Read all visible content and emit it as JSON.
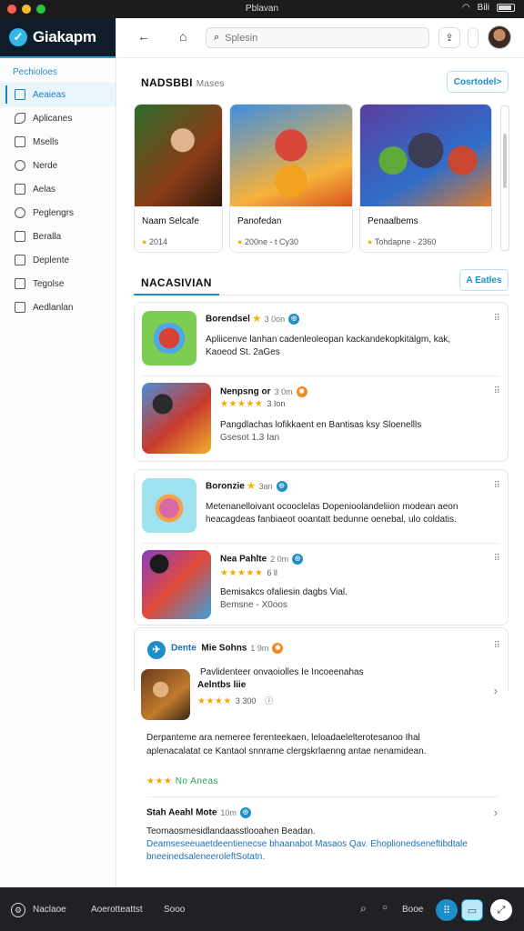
{
  "system": {
    "title": "Pblavan",
    "battery_label": "Bili"
  },
  "sidebar": {
    "brand": "Giakapm",
    "section": "Pechioloes",
    "items": [
      {
        "label": "Aeaieas",
        "icon": "apps-icon"
      },
      {
        "label": "Aplicanes",
        "icon": "leaf-icon"
      },
      {
        "label": "Msells",
        "icon": "grid-icon"
      },
      {
        "label": "Nerde",
        "icon": "user-icon"
      },
      {
        "label": "Aelas",
        "icon": "shield-icon"
      },
      {
        "label": "Peglengrs",
        "icon": "gear-icon"
      },
      {
        "label": "Beralla",
        "icon": "document-icon"
      },
      {
        "label": "Deplente",
        "icon": "edit-icon"
      },
      {
        "label": "Tegolse",
        "icon": "list-icon"
      },
      {
        "label": "Aedlanlan",
        "icon": "book-icon"
      }
    ]
  },
  "header": {
    "search_placeholder": "Splesin"
  },
  "featured": {
    "title": "NADSBBI",
    "subtitle": "Mases",
    "action": "Cosrtodel>",
    "cards": [
      {
        "name": "Naam Selcafe",
        "meta": "2014"
      },
      {
        "name": "Panofedan",
        "meta": "200ne - t Cy30"
      },
      {
        "name": "Penaalbems",
        "meta": "Tohdapne - 2360"
      }
    ]
  },
  "list_section": {
    "title": "NACASIVIAN",
    "action": "A Eatles"
  },
  "apps": [
    {
      "name": "Borendsel",
      "time": "3 0on",
      "desc": "Apliicenve lanhan cadenleoleopan kackandekopkitalgm, kak, Kaoeod St. 2aGes"
    },
    {
      "name": "Nenpsng or",
      "time": "3 0m",
      "rating_text": "3 Ion",
      "desc": "Pangdlachas lofikkaent en Bantisas ksy Sloenellls",
      "sub": "Gsesot 1.3 Ian"
    },
    {
      "name": "Boronzie",
      "time": "3an",
      "desc": "Metenanelloivant ocooclelas Dopenioolandeliion modean aeon heacagdeas fanbiaeot ooantatt bedunne oenebal, ulo coldatis."
    },
    {
      "name": "Nea Pahlte",
      "time": "2 0m",
      "rating_text": "6 ll",
      "desc": "Bemisakcs ofaliesin dagbs Vial.",
      "sub": "Bemsne - X0oos"
    },
    {
      "name": "Dente",
      "extra": "Mie Sohns",
      "time": "1 9m",
      "desc": "Pavlidenteer onvaoiolles Ie Incoeenahas"
    },
    {
      "name": "Aelntbs liie",
      "count": "3 300"
    }
  ],
  "review": {
    "text": "Derpanteme ara nemeree ferenteekaen, leloadaelelterotesanoo Ihal aplenacalatat ce Kantaol snnrame clergskrlaenng antae nenamidean.",
    "stars_label": "No Aneas"
  },
  "footer_item": {
    "title": "Stah Aeahl Mote",
    "time": "10m",
    "desc": "Teomaosmesidlandaasstlooahen Beadan.",
    "link": "Deamseseeuaetdeentienecse bhaanabot Masaos Qav. Ehoplionedseneftibdtale bneeinedsaleneeroleftSotatn."
  },
  "bottombar": {
    "left1": "Naclaoe",
    "left2": "Aoerotteattst",
    "left3": "Sooo",
    "right": "Booe"
  },
  "colors": {
    "accent": "#1d8ec8",
    "star": "#f2a900",
    "sidebar_brand_bg": "#0f1d2b"
  }
}
